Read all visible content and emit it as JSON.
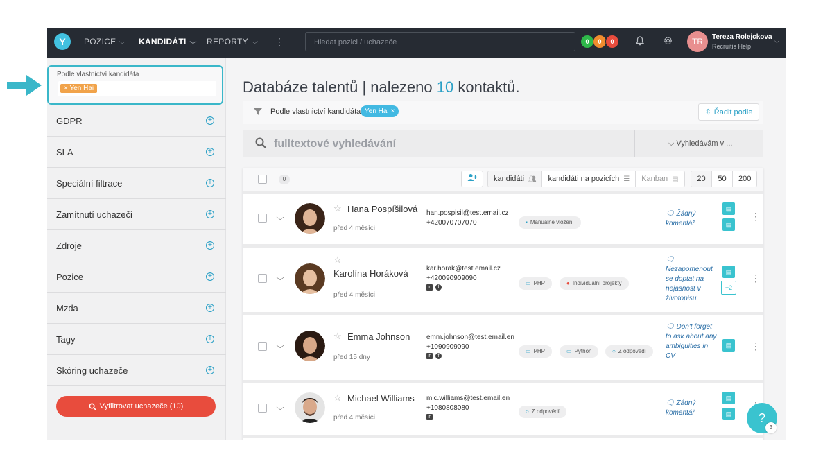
{
  "topbar": {
    "logo": "Y",
    "nav": [
      {
        "label": "POZICE",
        "active": false
      },
      {
        "label": "KANDIDÁTI",
        "active": true
      },
      {
        "label": "REPORTY",
        "active": false
      }
    ],
    "search_placeholder": "Hledat pozici / uchazeče",
    "badges": [
      {
        "value": "0",
        "color": "#2eb84a"
      },
      {
        "value": "0",
        "color": "#f08c2e"
      },
      {
        "value": "0",
        "color": "#e84c3d"
      }
    ],
    "user": {
      "initials": "TR",
      "name": "Tereza Rolejckova",
      "org": "Recruitis Help"
    }
  },
  "sidebar": {
    "owner_filter": {
      "label": "Podle vlastnictví kandidáta",
      "tag": "Yen Hai"
    },
    "filters": [
      "GDPR",
      "SLA",
      "Speciální filtrace",
      "Zamítnutí uchazeči",
      "Zdroje",
      "Pozice",
      "Mzda",
      "Tagy",
      "Skóring uchazeče"
    ],
    "filter_button": "Vyfiltrovat uchazeče (10)"
  },
  "main": {
    "title_prefix": "Databáze talentů | nalezeno",
    "title_count": "10",
    "title_suffix": "kontaktů.",
    "active_filter_label": "Podle vlastnictví kandidáta:",
    "active_filter_tag": "Yen Hai",
    "sort_label": "Řadit podle",
    "fulltext_placeholder": "fulltextové vyhledávání",
    "search_in_label": "Vyhledávám v ..."
  },
  "table": {
    "selected_count": "0",
    "views": [
      {
        "label": "kandidáti",
        "active": true
      },
      {
        "label": "kandidáti na pozicích",
        "active": false
      },
      {
        "label": "Kanban",
        "active": false
      }
    ],
    "page_sizes": [
      {
        "label": "20",
        "active": true
      },
      {
        "label": "50",
        "active": false
      },
      {
        "label": "200",
        "active": false
      }
    ],
    "rows": [
      {
        "name": "Hana Pospíšilová",
        "age": "před 4 měsíci",
        "email": "han.pospisil@test.email.cz",
        "phone": "+420070707070",
        "tags": [
          {
            "label": "Manuálně vložení",
            "icon": "briefcase-icon"
          }
        ],
        "comment": "Žádný komentář"
      },
      {
        "name": "Karolína Horáková",
        "age": "před 4 měsíci",
        "email": "kar.horak@test.email.cz",
        "phone": "+420090909090",
        "tags": [
          {
            "label": "PHP",
            "icon": "monitor-icon"
          },
          {
            "label": "Individuální projekty",
            "icon": "person-icon"
          }
        ],
        "comment": "Nezapomenout se doptat na nejasnost v životopisu.",
        "more_docs": "+2"
      },
      {
        "name": "Emma Johnson",
        "age": "před 15 dny",
        "email": "emm.johnson@test.email.en",
        "phone": "+1090909090",
        "tags": [
          {
            "label": "PHP",
            "icon": "monitor-icon"
          },
          {
            "label": "Python",
            "icon": "monitor-icon"
          },
          {
            "label": "Z odpovědí",
            "icon": "chat-icon"
          }
        ],
        "comment": "Don't forget to ask about any ambiguities in CV"
      },
      {
        "name": "Michael Williams",
        "age": "před 4 měsíci",
        "email": "mic.williams@test.email.en",
        "phone": "+1080808080",
        "tags": [
          {
            "label": "Z odpovědí",
            "icon": "chat-icon"
          }
        ],
        "comment": "Žádný komentář"
      }
    ]
  },
  "help": {
    "symbol": "?",
    "count": "3"
  }
}
